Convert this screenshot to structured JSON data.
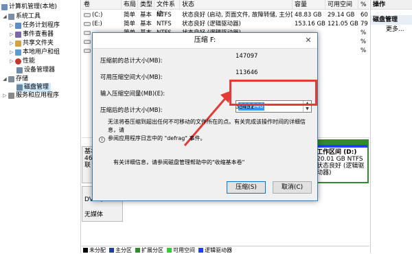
{
  "tree": {
    "items": [
      {
        "label": "计算机管理(本地)",
        "color": "#6c8fb8"
      },
      {
        "label": "系统工具",
        "color": "#7a8fa6"
      },
      {
        "label": "任务计划程序",
        "color": "#5b8dc9"
      },
      {
        "label": "事件查看器",
        "color": "#7b68a6"
      },
      {
        "label": "共享文件夹",
        "color": "#d1a344"
      },
      {
        "label": "本地用户和组",
        "color": "#5d9bd1"
      },
      {
        "label": "性能",
        "color": "#c0392b"
      },
      {
        "label": "设备管理器",
        "color": "#6e8aa6"
      },
      {
        "label": "存储",
        "color": "#7e8c99"
      },
      {
        "label": "磁盘管理",
        "color": "#6a86a3"
      },
      {
        "label": "服务和应用程序",
        "color": "#8a8a8a"
      }
    ]
  },
  "columns": [
    "卷",
    "布局",
    "类型",
    "文件系统",
    "状态",
    "容量",
    "可用空间",
    "%"
  ],
  "volumes": [
    {
      "name": "(C:)",
      "layout": "简单",
      "type": "基本",
      "fs": "NTFS",
      "status": "状态良好 (启动, 页面文件, 故障转储, 主分区)",
      "capacity": "48.83 GB",
      "free": "29.14 GB",
      "pct": "60"
    },
    {
      "name": "(E:)",
      "layout": "简单",
      "type": "基本",
      "fs": "NTFS",
      "status": "状态良好 (逻辑驱动器)",
      "capacity": "153.16 GB",
      "free": "121.05 GB",
      "pct": "79"
    },
    {
      "name": "",
      "layout": "简单",
      "type": "基本",
      "fs": "NTFS",
      "status": "状态良好 (逻辑驱动器)",
      "capacity": "",
      "free": "",
      "pct": "%"
    },
    {
      "name": "工",
      "layout": "",
      "type": "",
      "fs": "",
      "status": "",
      "capacity": "",
      "free": "",
      "pct": "%"
    },
    {
      "name": "",
      "layout": "",
      "type": "",
      "fs": "",
      "status": "",
      "capacity": "",
      "free": "",
      "pct": "%"
    }
  ],
  "actions": {
    "header": "操作",
    "section": "磁盘管理",
    "more": "更多..."
  },
  "disk": {
    "disk0_a": "基本",
    "disk0_b": "465",
    "disk0_c": "联",
    "part_title": "工作区间 (D:)",
    "part_size": "20.01 GB NTFS",
    "part_status": "状态良好 (逻辑驱动器)",
    "dvd_label": "DVD (",
    "no_media": "无媒体"
  },
  "legend": [
    {
      "label": "未分配",
      "color": "#000000"
    },
    {
      "label": "主分区",
      "color": "#1f3f9f"
    },
    {
      "label": "扩展分区",
      "color": "#2e8b2e"
    },
    {
      "label": "可用空间",
      "color": "#32cd32"
    },
    {
      "label": "逻辑驱动器",
      "color": "#1e40ff"
    }
  ],
  "dialog": {
    "title": "压缩 F:",
    "close": "✕",
    "before_label": "压缩前的总计大小(MB):",
    "before_value": "147097",
    "available_label": "可用压缩空间大小(MB):",
    "available_value": "113646",
    "input_label": "输入压缩空间量(MB)(E):",
    "input_value": "113646",
    "after_label": "压缩后的总计大小(MB):",
    "after_value": "33451",
    "info_text_1": "无法将卷压缩到超出任何不可移动的文件所在的点。有关完成该操作时间的详细信息，请",
    "info_text_2": "参阅应用程序日志中的 \"defrag\" 事件。",
    "help_text": "有关详细信息，请参阅磁盘管理帮助中的\"收缩基本卷\"",
    "shrink_button": "压缩(S)",
    "cancel_button": "取消(C)"
  },
  "colors": {
    "highlight": "#e53935",
    "selection": "#3399ff"
  }
}
